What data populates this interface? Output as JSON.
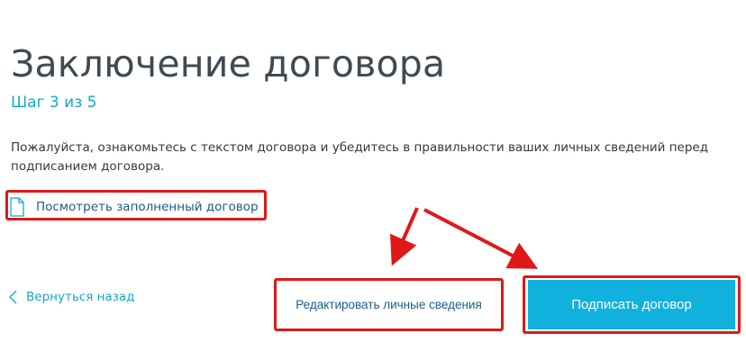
{
  "page": {
    "title": "Заключение договора",
    "step": "Шаг 3 из 5",
    "description": "Пожалуйста, ознакомьтесь с текстом договора и убедитесь в правильности ваших личных сведений перед подписанием договора."
  },
  "links": {
    "view_contract": "Посмотреть заполненный договор",
    "back": "Вернуться назад"
  },
  "buttons": {
    "edit_personal": "Редактировать личные сведения",
    "sign_contract": "Подписать договор"
  },
  "icons": {
    "view_contract": "document-icon",
    "back": "chevron-left-icon"
  },
  "colors": {
    "accent": "#11b1dd",
    "link": "#1a5d8a",
    "title": "#3f4a52",
    "highlight": "#e01818"
  }
}
